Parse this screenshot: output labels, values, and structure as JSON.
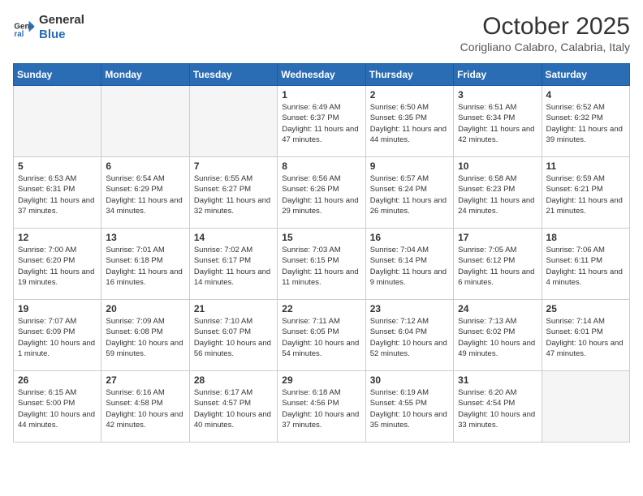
{
  "header": {
    "logo_line1": "General",
    "logo_line2": "Blue",
    "month": "October 2025",
    "location": "Corigliano Calabro, Calabria, Italy"
  },
  "weekdays": [
    "Sunday",
    "Monday",
    "Tuesday",
    "Wednesday",
    "Thursday",
    "Friday",
    "Saturday"
  ],
  "weeks": [
    [
      {
        "day": "",
        "empty": true
      },
      {
        "day": "",
        "empty": true
      },
      {
        "day": "",
        "empty": true
      },
      {
        "day": "1",
        "sunrise": "6:49 AM",
        "sunset": "6:37 PM",
        "daylight": "11 hours and 47 minutes."
      },
      {
        "day": "2",
        "sunrise": "6:50 AM",
        "sunset": "6:35 PM",
        "daylight": "11 hours and 44 minutes."
      },
      {
        "day": "3",
        "sunrise": "6:51 AM",
        "sunset": "6:34 PM",
        "daylight": "11 hours and 42 minutes."
      },
      {
        "day": "4",
        "sunrise": "6:52 AM",
        "sunset": "6:32 PM",
        "daylight": "11 hours and 39 minutes."
      }
    ],
    [
      {
        "day": "5",
        "sunrise": "6:53 AM",
        "sunset": "6:31 PM",
        "daylight": "11 hours and 37 minutes."
      },
      {
        "day": "6",
        "sunrise": "6:54 AM",
        "sunset": "6:29 PM",
        "daylight": "11 hours and 34 minutes."
      },
      {
        "day": "7",
        "sunrise": "6:55 AM",
        "sunset": "6:27 PM",
        "daylight": "11 hours and 32 minutes."
      },
      {
        "day": "8",
        "sunrise": "6:56 AM",
        "sunset": "6:26 PM",
        "daylight": "11 hours and 29 minutes."
      },
      {
        "day": "9",
        "sunrise": "6:57 AM",
        "sunset": "6:24 PM",
        "daylight": "11 hours and 26 minutes."
      },
      {
        "day": "10",
        "sunrise": "6:58 AM",
        "sunset": "6:23 PM",
        "daylight": "11 hours and 24 minutes."
      },
      {
        "day": "11",
        "sunrise": "6:59 AM",
        "sunset": "6:21 PM",
        "daylight": "11 hours and 21 minutes."
      }
    ],
    [
      {
        "day": "12",
        "sunrise": "7:00 AM",
        "sunset": "6:20 PM",
        "daylight": "11 hours and 19 minutes."
      },
      {
        "day": "13",
        "sunrise": "7:01 AM",
        "sunset": "6:18 PM",
        "daylight": "11 hours and 16 minutes."
      },
      {
        "day": "14",
        "sunrise": "7:02 AM",
        "sunset": "6:17 PM",
        "daylight": "11 hours and 14 minutes."
      },
      {
        "day": "15",
        "sunrise": "7:03 AM",
        "sunset": "6:15 PM",
        "daylight": "11 hours and 11 minutes."
      },
      {
        "day": "16",
        "sunrise": "7:04 AM",
        "sunset": "6:14 PM",
        "daylight": "11 hours and 9 minutes."
      },
      {
        "day": "17",
        "sunrise": "7:05 AM",
        "sunset": "6:12 PM",
        "daylight": "11 hours and 6 minutes."
      },
      {
        "day": "18",
        "sunrise": "7:06 AM",
        "sunset": "6:11 PM",
        "daylight": "11 hours and 4 minutes."
      }
    ],
    [
      {
        "day": "19",
        "sunrise": "7:07 AM",
        "sunset": "6:09 PM",
        "daylight": "10 hours and 1 minute."
      },
      {
        "day": "20",
        "sunrise": "7:09 AM",
        "sunset": "6:08 PM",
        "daylight": "10 hours and 59 minutes."
      },
      {
        "day": "21",
        "sunrise": "7:10 AM",
        "sunset": "6:07 PM",
        "daylight": "10 hours and 56 minutes."
      },
      {
        "day": "22",
        "sunrise": "7:11 AM",
        "sunset": "6:05 PM",
        "daylight": "10 hours and 54 minutes."
      },
      {
        "day": "23",
        "sunrise": "7:12 AM",
        "sunset": "6:04 PM",
        "daylight": "10 hours and 52 minutes."
      },
      {
        "day": "24",
        "sunrise": "7:13 AM",
        "sunset": "6:02 PM",
        "daylight": "10 hours and 49 minutes."
      },
      {
        "day": "25",
        "sunrise": "7:14 AM",
        "sunset": "6:01 PM",
        "daylight": "10 hours and 47 minutes."
      }
    ],
    [
      {
        "day": "26",
        "sunrise": "6:15 AM",
        "sunset": "5:00 PM",
        "daylight": "10 hours and 44 minutes."
      },
      {
        "day": "27",
        "sunrise": "6:16 AM",
        "sunset": "4:58 PM",
        "daylight": "10 hours and 42 minutes."
      },
      {
        "day": "28",
        "sunrise": "6:17 AM",
        "sunset": "4:57 PM",
        "daylight": "10 hours and 40 minutes."
      },
      {
        "day": "29",
        "sunrise": "6:18 AM",
        "sunset": "4:56 PM",
        "daylight": "10 hours and 37 minutes."
      },
      {
        "day": "30",
        "sunrise": "6:19 AM",
        "sunset": "4:55 PM",
        "daylight": "10 hours and 35 minutes."
      },
      {
        "day": "31",
        "sunrise": "6:20 AM",
        "sunset": "4:54 PM",
        "daylight": "10 hours and 33 minutes."
      },
      {
        "day": "",
        "empty": true
      }
    ]
  ]
}
